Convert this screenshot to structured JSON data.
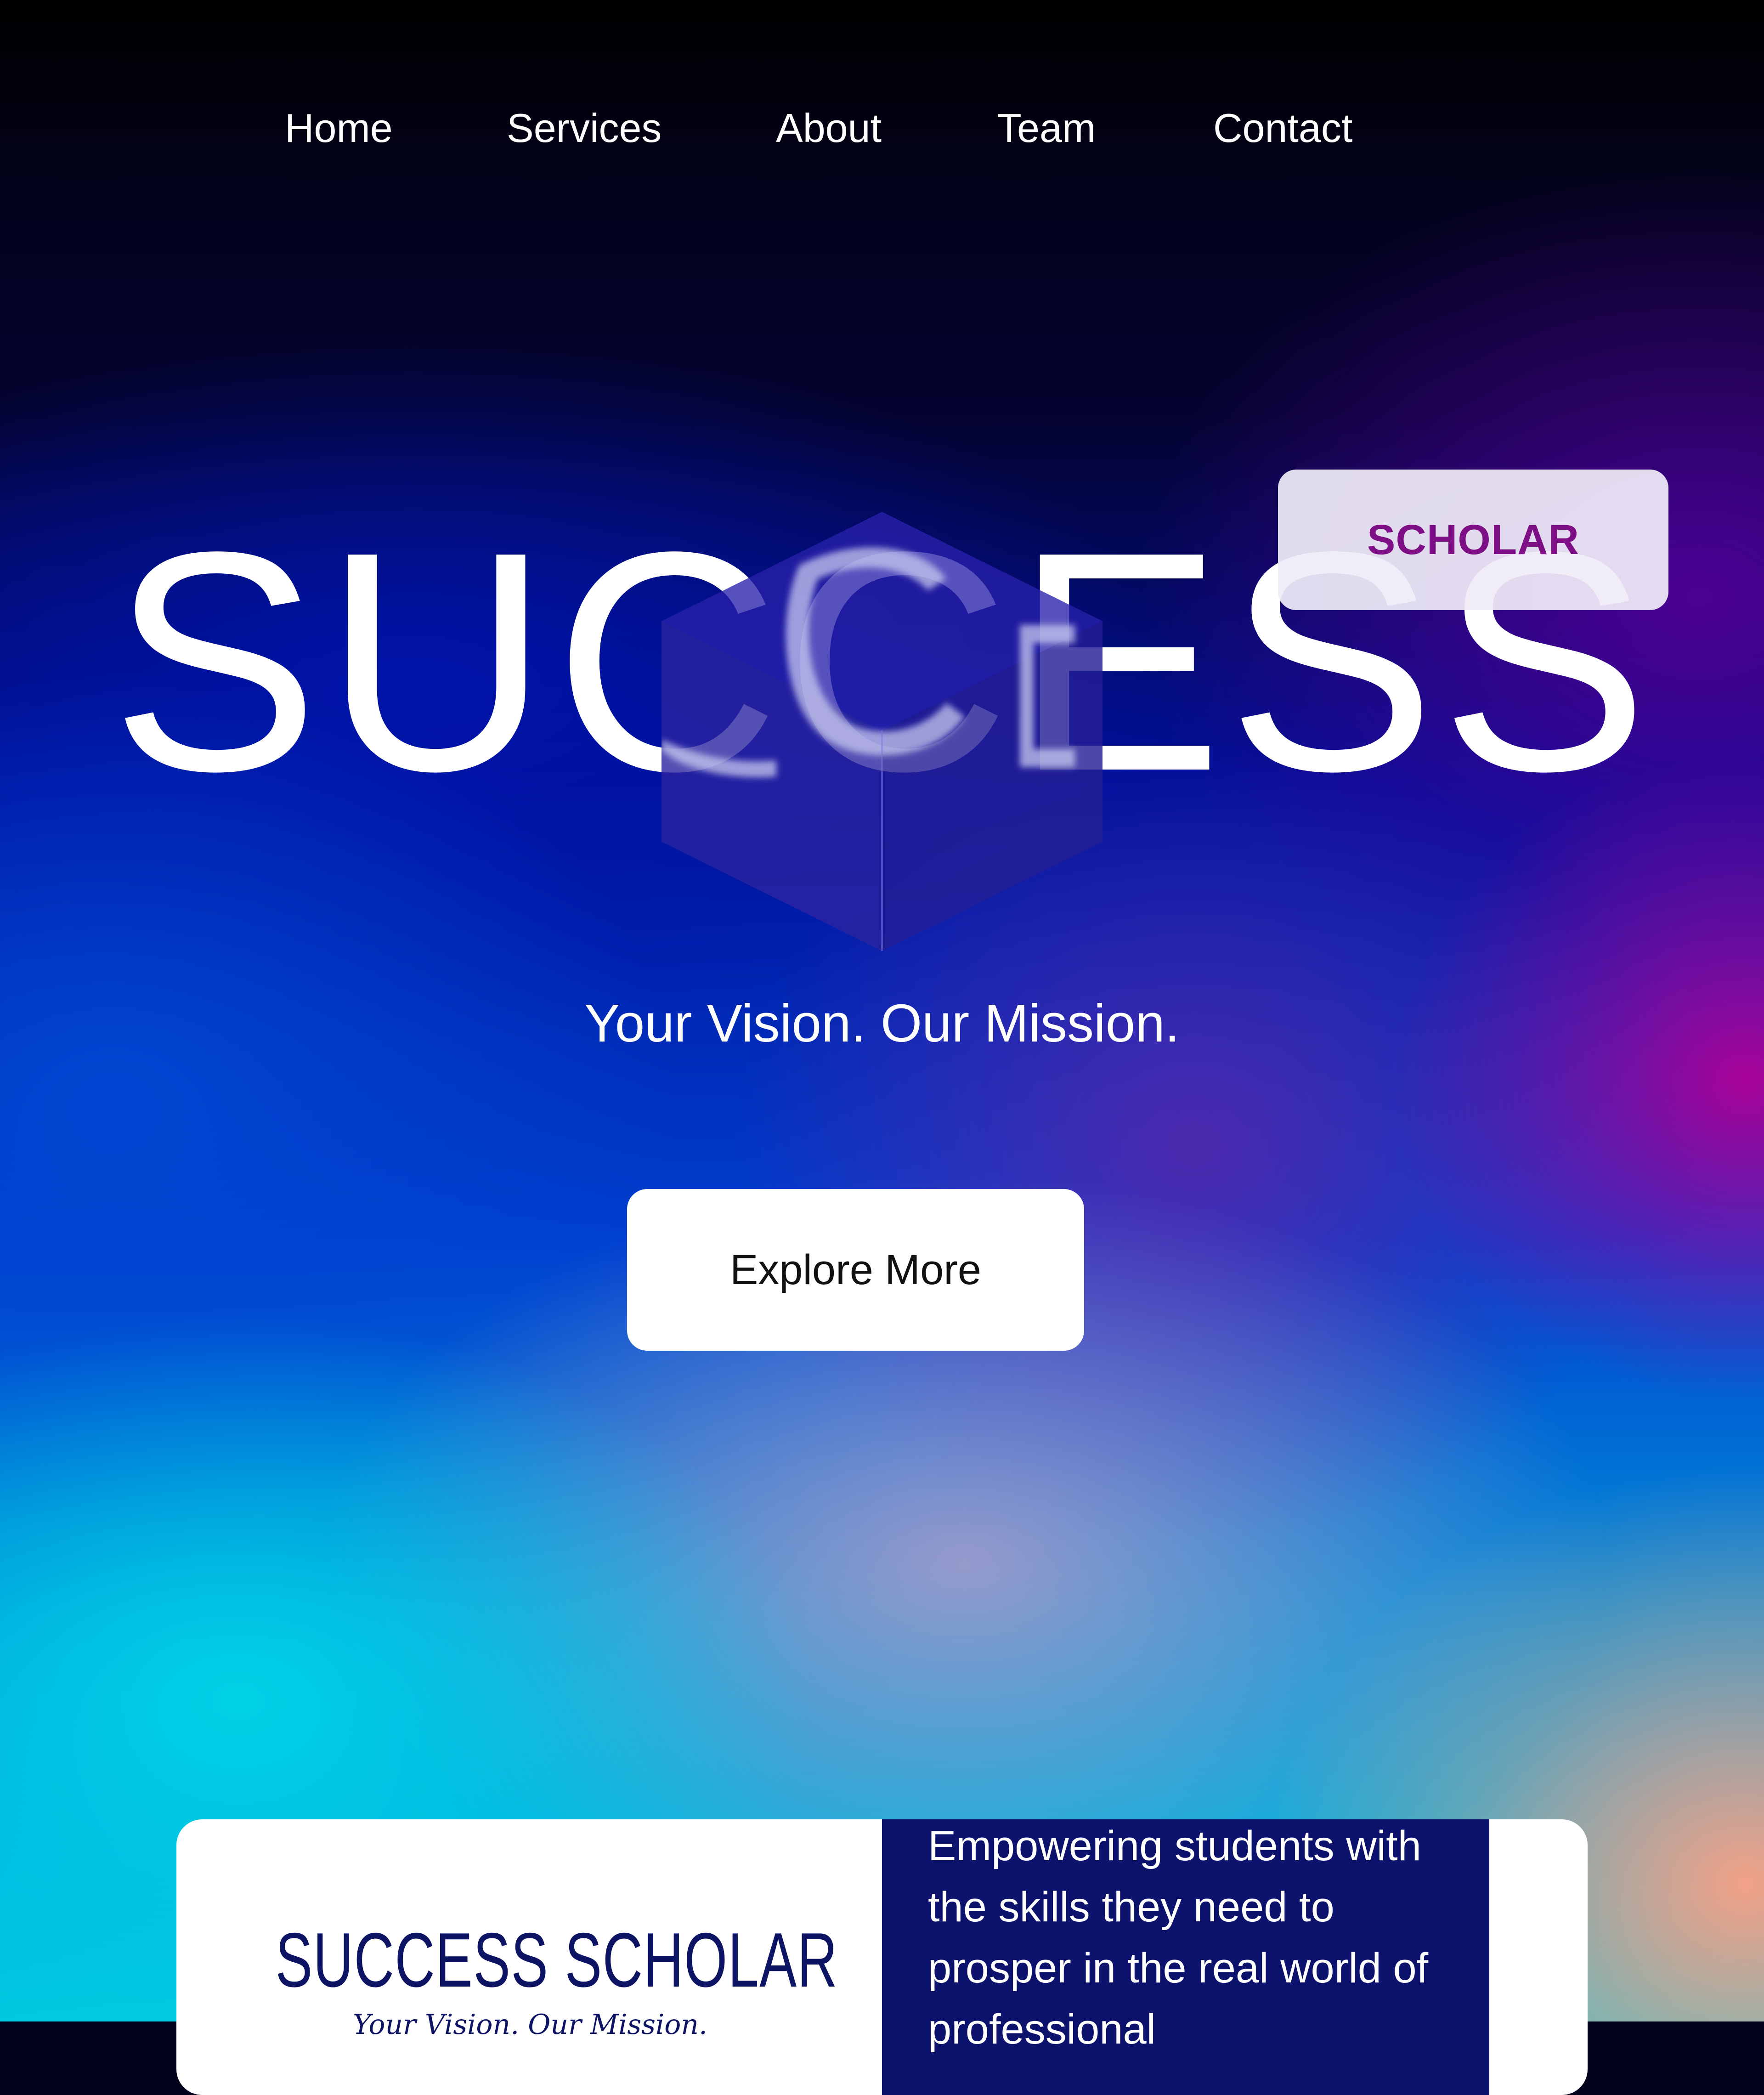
{
  "nav": {
    "items": [
      {
        "label": "Home"
      },
      {
        "label": "Services"
      },
      {
        "label": "About"
      },
      {
        "label": "Team"
      },
      {
        "label": "Contact"
      }
    ]
  },
  "hero": {
    "title": "SUCCESS",
    "badge": "SCHOLAR",
    "tagline": "Your Vision. Our Mission.",
    "cta_label": "Explore More"
  },
  "card": {
    "logo_title": "SUCCESS SCHOLAR",
    "logo_subtitle": "Your Vision. Our Mission.",
    "description": "Empowering students with the skills they need to prosper in the real world of professional"
  },
  "colors": {
    "badge_text": "#7d0e86",
    "card_panel": "#0d136d",
    "logo_ink": "#0e1464"
  }
}
